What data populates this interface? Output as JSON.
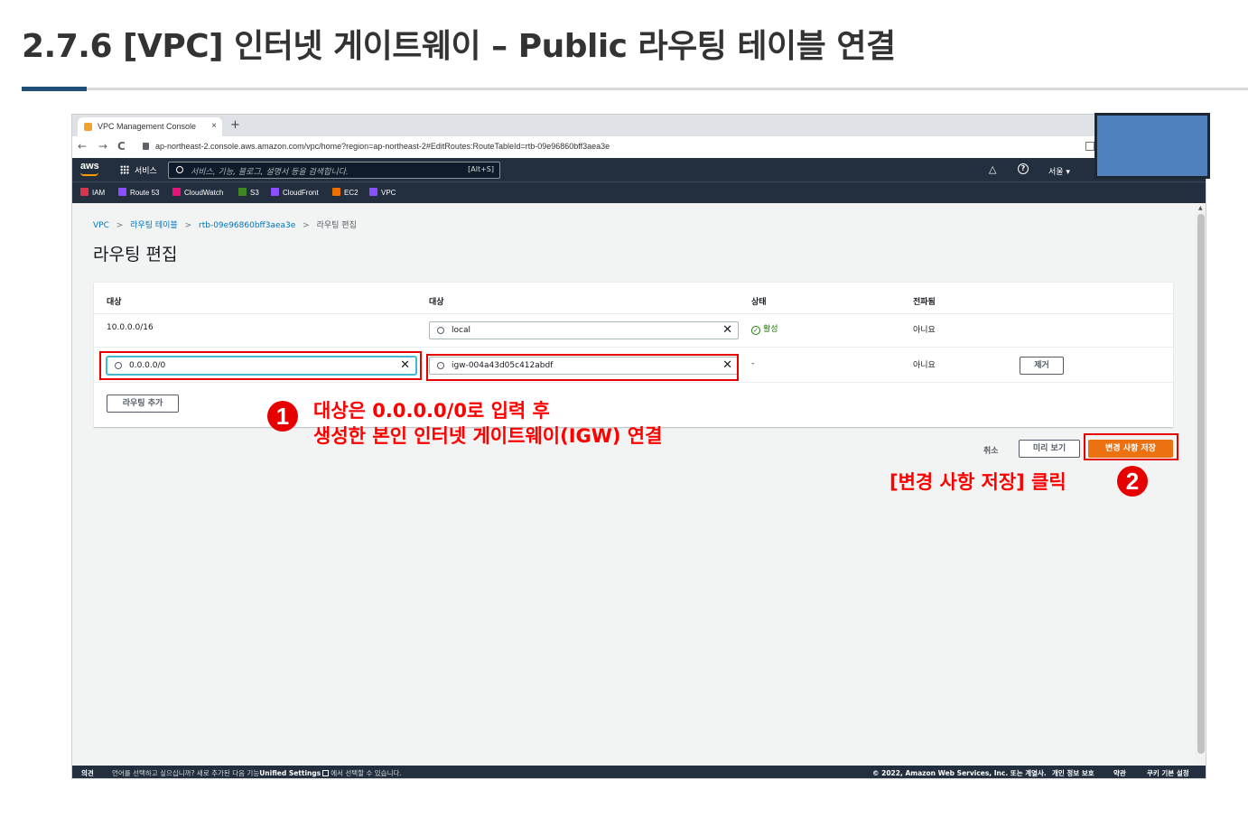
{
  "slide": {
    "title": "2.7.6 [VPC] 인터넷 게이트웨이 – Public 라우팅 테이블 연결"
  },
  "browser": {
    "tab_title": "VPC Management Console",
    "tab_close": "×",
    "new_tab": "+",
    "back": "←",
    "forward": "→",
    "reload": "C",
    "url": "ap-northeast-2.console.aws.amazon.com/vpc/home?region=ap-northeast-2#EditRoutes:RouteTableId=rtb-09e96860bff3aea3e"
  },
  "aws_nav": {
    "logo": "aws",
    "services": "서비스",
    "search_placeholder": "서비스, 기능, 블로그, 설명서 등을 검색합니다.",
    "search_shortcut": "[Alt+S]",
    "help": "?",
    "region": "서울 ▾"
  },
  "favorites": [
    {
      "label": "IAM",
      "color": "#dd344c"
    },
    {
      "label": "Route 53",
      "color": "#8c4fff"
    },
    {
      "label": "CloudWatch",
      "color": "#e7157b"
    },
    {
      "label": "S3",
      "color": "#3f8624"
    },
    {
      "label": "CloudFront",
      "color": "#8c4fff"
    },
    {
      "label": "EC2",
      "color": "#ed7100"
    },
    {
      "label": "VPC",
      "color": "#8c4fff"
    }
  ],
  "breadcrumb": {
    "items": [
      "VPC",
      "라우팅 테이블",
      "rtb-09e96860bff3aea3e",
      "라우팅 편집"
    ],
    "separator": ">"
  },
  "page": {
    "heading": "라우팅 편집"
  },
  "routes_table": {
    "headers": [
      "대상",
      "대상",
      "상태",
      "전파됨"
    ],
    "rows": [
      {
        "destination": "10.0.0.0/16",
        "target": "local",
        "status": "활성",
        "propagated": "아니요"
      },
      {
        "destination": "0.0.0.0/0",
        "target": "igw-004a43d05c412abdf",
        "status": "-",
        "propagated": "아니요",
        "remove_label": "제거"
      }
    ],
    "add_route_label": "라우팅 추가",
    "clear_glyph": "✕",
    "status_ok_glyph": "✓"
  },
  "actions": {
    "cancel": "취소",
    "preview": "미리 보기",
    "save": "변경 사항 저장"
  },
  "annotations": {
    "callout1_num": "1",
    "callout1_line1": "대상은 0.0.0.0/0로 입력 후",
    "callout1_line2": "생성한 본인 인터넷 게이트웨이(IGW) 연결",
    "callout2_num": "2",
    "callout2_text": "[변경 사항 저장] 클릭",
    "highlight_color": "#e60000"
  },
  "footer": {
    "feedback": "의견",
    "language_prompt": "언어를 선택하고 싶으십니까? 새로 추가된 다음 기능",
    "unified_settings": "Unified Settings",
    "language_suffix": "에서 선택할 수 있습니다.",
    "copyright": "© 2022, Amazon Web Services, Inc. 또는 계열사.",
    "privacy": "개인 정보 보호",
    "terms": "약관",
    "cookies": "쿠키 기본 설정"
  },
  "colors": {
    "aws_dark": "#232f3e",
    "aws_orange": "#ec7211",
    "link_blue": "#0073bb",
    "annotation_red": "#ff0000"
  }
}
